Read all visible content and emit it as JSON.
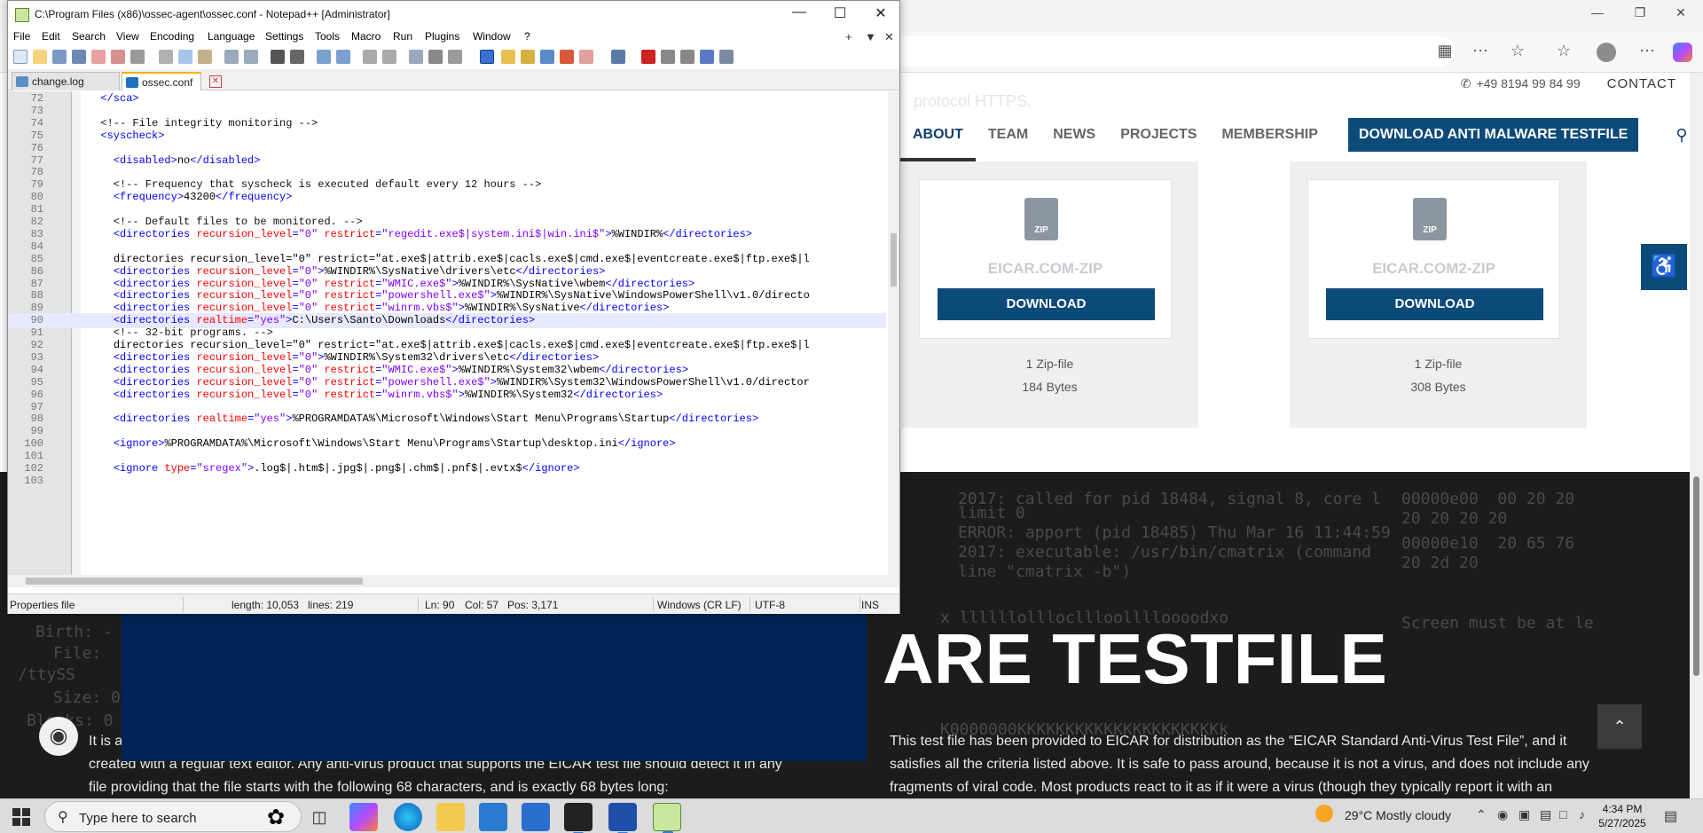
{
  "browser": {
    "contact": {
      "phone": "+49 8194 99 84 99",
      "contact_label": "CONTACT"
    },
    "faint_text": "protocol HTTPS.",
    "nav": [
      "ABOUT",
      "TEAM",
      "NEWS",
      "PROJECTS",
      "MEMBERSHIP"
    ],
    "cta": "DOWNLOAD ANTI MALWARE TESTFILE",
    "downloads": [
      {
        "icon_label": "ZIP",
        "name": "EICAR.COM-ZIP",
        "button": "DOWNLOAD",
        "type": "1 Zip-file",
        "size": "184 Bytes"
      },
      {
        "icon_label": "ZIP",
        "name": "EICAR.COM2-ZIP",
        "button": "DOWNLOAD",
        "type": "1 Zip-file",
        "size": "308 Bytes"
      }
    ],
    "hero": {
      "title": "ARE TESTFILE",
      "left_para": "It is a ... created with a regular text editor. Any anti-virus product that supports the EICAR test file should detect it in any file providing that the file starts with the following 68 characters, and is exactly 68 bytes long:",
      "left_para_lines": [
        "It is a",
        "created with a regular text editor. Any anti-virus product that supports the EICAR test file should detect it in any",
        "file providing that the file starts with the following 68 characters, and is exactly 68 bytes long:"
      ],
      "right_para_lines": [
        "This test file has been provided to EICAR for distribution as the “EICAR Standard Anti-Virus Test File”, and it",
        "satisfies all the criteria listed above. It is safe to pass around, because it is not a virus, and does not include any",
        "fragments of viral code. Most products react to it as if it were a virus (though they typically report it with an"
      ],
      "terminal_lines": [
        "2017: called for pid 18484, signal 8, core l",
        "limit 0",
        "ERROR: apport (pid 18485) Thu Mar 16 11:44:59",
        "2017: executable: /usr/bin/cmatrix (command",
        "line \"cmatrix -b\")",
        "x llllllolllocllloolllloooodxo",
        "K0000000KKKKKKKKKKKKKKKKKKKKKk",
        "Birth: -",
        "File:",
        "/ttySS",
        "Size: 0",
        "Blocks: 0",
        "Screen must be at le",
        "00000e00  00 20 20",
        "20 20 20 20",
        "00000e10  20 65 76",
        "20 2d 20"
      ]
    }
  },
  "npp": {
    "title": "C:\\Program Files (x86)\\ossec-agent\\ossec.conf - Notepad++ [Administrator]",
    "menu": [
      "File",
      "Edit",
      "Search",
      "View",
      "Encoding",
      "Language",
      "Settings",
      "Tools",
      "Macro",
      "Run",
      "Plugins",
      "Window",
      "?"
    ],
    "menu_right": [
      "+",
      "▼",
      "✕"
    ],
    "tabs": [
      {
        "label": "change.log",
        "active": false
      },
      {
        "label": "ossec.conf",
        "active": true
      }
    ],
    "lines": [
      {
        "n": "72",
        "text": "  </sca>"
      },
      {
        "n": "73",
        "text": ""
      },
      {
        "n": "74",
        "text": "  <!-- File integrity monitoring -->"
      },
      {
        "n": "75",
        "text": "  <syscheck>"
      },
      {
        "n": "76",
        "text": ""
      },
      {
        "n": "77",
        "text": "    <disabled>no</disabled>"
      },
      {
        "n": "78",
        "text": ""
      },
      {
        "n": "79",
        "text": "    <!-- Frequency that syscheck is executed default every 12 hours -->"
      },
      {
        "n": "80",
        "text": "    <frequency>43200</frequency>"
      },
      {
        "n": "81",
        "text": ""
      },
      {
        "n": "82",
        "text": "    <!-- Default files to be monitored. -->"
      },
      {
        "n": "83",
        "text": "    <directories recursion_level=\"0\" restrict=\"regedit.exe$|system.ini$|win.ini$\">%WINDIR%</directories>"
      },
      {
        "n": "84",
        "text": ""
      },
      {
        "n": "85",
        "text": "    <directories recursion_level=\"0\" restrict=\"at.exe$|attrib.exe$|cacls.exe$|cmd.exe$|eventcreate.exe$|ftp.exe$|l"
      },
      {
        "n": "86",
        "text": "    <directories recursion_level=\"0\">%WINDIR%\\SysNative\\drivers\\etc</directories>"
      },
      {
        "n": "87",
        "text": "    <directories recursion_level=\"0\" restrict=\"WMIC.exe$\">%WINDIR%\\SysNative\\wbem</directories>"
      },
      {
        "n": "88",
        "text": "    <directories recursion_level=\"0\" restrict=\"powershell.exe$\">%WINDIR%\\SysNative\\WindowsPowerShell\\v1.0</directo"
      },
      {
        "n": "89",
        "text": "    <directories recursion_level=\"0\" restrict=\"winrm.vbs$\">%WINDIR%\\SysNative</directories>"
      },
      {
        "n": "90",
        "text": "    <directories realtime=\"yes\">C:\\Users\\Santo\\Downloads</directories>"
      },
      {
        "n": "91",
        "text": "    <!-- 32-bit programs. -->"
      },
      {
        "n": "92",
        "text": "    <directories recursion_level=\"0\" restrict=\"at.exe$|attrib.exe$|cacls.exe$|cmd.exe$|eventcreate.exe$|ftp.exe$|l"
      },
      {
        "n": "93",
        "text": "    <directories recursion_level=\"0\">%WINDIR%\\System32\\drivers\\etc</directories>"
      },
      {
        "n": "94",
        "text": "    <directories recursion_level=\"0\" restrict=\"WMIC.exe$\">%WINDIR%\\System32\\wbem</directories>"
      },
      {
        "n": "95",
        "text": "    <directories recursion_level=\"0\" restrict=\"powershell.exe$\">%WINDIR%\\System32\\WindowsPowerShell\\v1.0</director"
      },
      {
        "n": "96",
        "text": "    <directories recursion_level=\"0\" restrict=\"winrm.vbs$\">%WINDIR%\\System32</directories>"
      },
      {
        "n": "97",
        "text": ""
      },
      {
        "n": "98",
        "text": "    <directories realtime=\"yes\">%PROGRAMDATA%\\Microsoft\\Windows\\Start Menu\\Programs\\Startup</directories>"
      },
      {
        "n": "99",
        "text": ""
      },
      {
        "n": "100",
        "text": "    <ignore>%PROGRAMDATA%\\Microsoft\\Windows\\Start Menu\\Programs\\Startup\\desktop.ini</ignore>"
      },
      {
        "n": "101",
        "text": ""
      },
      {
        "n": "102",
        "text": "    <ignore type=\"sregex\">.log$|.htm$|.jpg$|.png$|.chm$|.pnf$|.evtx$</ignore>"
      },
      {
        "n": "103",
        "text": ""
      }
    ],
    "current_line": "90",
    "status": {
      "filetype": "Properties file",
      "length": "length: 10,053",
      "lines": "lines: 219",
      "ln": "Ln: 90",
      "col": "Col: 57",
      "pos": "Pos: 3,171",
      "eol": "Windows (CR LF)",
      "encoding": "UTF-8",
      "mode": "INS"
    }
  },
  "taskbar": {
    "search_placeholder": "Type here to search",
    "weather": "29°C  Mostly cloudy",
    "time": "4:34 PM",
    "date": "5/27/2025"
  }
}
